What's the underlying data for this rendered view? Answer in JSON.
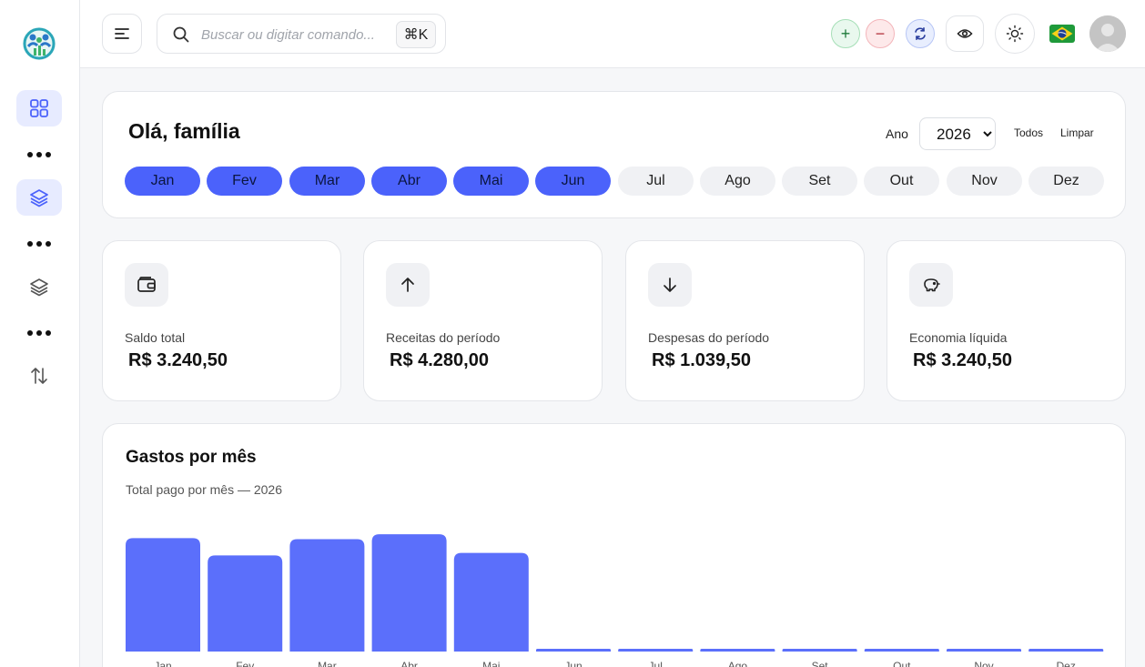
{
  "search": {
    "placeholder": "Buscar ou digitar comando...",
    "shortcut": "⌘K"
  },
  "header": {
    "greeting": "Olá, família",
    "year_label": "Ano",
    "year_value": "2026",
    "year_options": [
      "2026"
    ],
    "all_label": "Todos",
    "clear_label": "Limpar"
  },
  "months": [
    {
      "label": "Jan",
      "selected": true
    },
    {
      "label": "Fev",
      "selected": true
    },
    {
      "label": "Mar",
      "selected": true
    },
    {
      "label": "Abr",
      "selected": true
    },
    {
      "label": "Mai",
      "selected": true
    },
    {
      "label": "Jun",
      "selected": true
    },
    {
      "label": "Jul",
      "selected": false
    },
    {
      "label": "Ago",
      "selected": false
    },
    {
      "label": "Set",
      "selected": false
    },
    {
      "label": "Out",
      "selected": false
    },
    {
      "label": "Nov",
      "selected": false
    },
    {
      "label": "Dez",
      "selected": false
    }
  ],
  "stats": [
    {
      "icon": "wallet-icon",
      "label": "Saldo total",
      "value": "R$ 3.240,50"
    },
    {
      "icon": "arrow-up-icon",
      "label": "Receitas do período",
      "value": "R$ 4.280,00"
    },
    {
      "icon": "arrow-down-icon",
      "label": "Despesas do período",
      "value": "R$ 1.039,50"
    },
    {
      "icon": "piggy-bank-icon",
      "label": "Economia líquida",
      "value": "R$ 3.240,50"
    }
  ],
  "colors": {
    "accent": "#4b62fb",
    "bar": "#5b6ffb",
    "chip": "#f0f1f4"
  },
  "chart_data": {
    "type": "bar",
    "title": "Gastos por mês",
    "subtitle": "Total pago por mês — 2026",
    "categories": [
      "Jan",
      "Fev",
      "Mar",
      "Abr",
      "Mai",
      "Jun",
      "Jul",
      "Ago",
      "Set",
      "Out",
      "Nov",
      "Dez"
    ],
    "values": [
      230,
      195,
      228,
      238,
      200,
      0,
      0,
      0,
      0,
      0,
      0,
      0
    ],
    "ylim": [
      0,
      240
    ],
    "grid": false,
    "legend": "none"
  }
}
